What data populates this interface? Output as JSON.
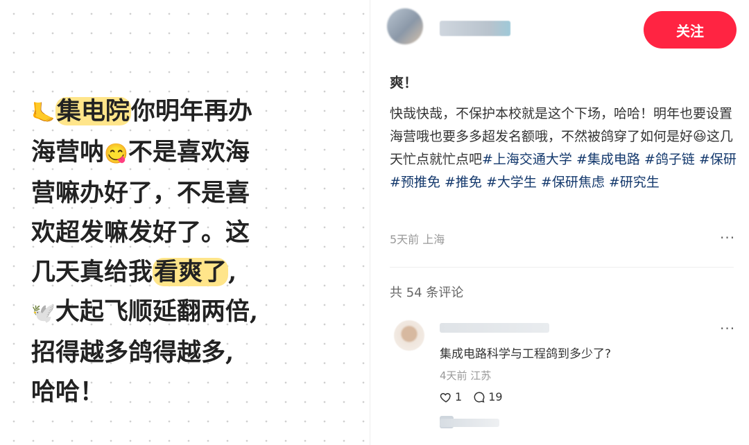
{
  "note_image": {
    "lines": [
      {
        "emoji": "🦶",
        "hl": "集电院",
        "text": "你明年再办"
      },
      {
        "text_a": "海营呐",
        "emoji": "😋",
        "text_b": "不是喜欢海"
      },
      {
        "text": "营嘛办好了，不是喜"
      },
      {
        "text": "欢超发嘛发好了。这"
      },
      {
        "text_a": "几天真给我",
        "hl": "看爽了",
        "text_b": ","
      },
      {
        "emoji": "🕊️",
        "text": "大起飞顺延翻两倍,"
      },
      {
        "text": "招得越多鸽得越多,"
      },
      {
        "text": "哈哈！"
      }
    ]
  },
  "header": {
    "follow_label": "关注"
  },
  "post": {
    "title": "爽！",
    "body_1": "快哉快哉，不保护本校就是这个下场，哈哈！明年也要设置海营哦也要多多超发名额哦，不然被鸽穿了如何是好",
    "body_emoji": "😆",
    "body_2": "这几天忙点就忙点吧",
    "tags": [
      "#上海交通大学",
      "#集成电路",
      "#鸽子链",
      "#保研",
      "#预推免",
      "#推免",
      "#大学生",
      "#保研焦虑",
      "#研究生"
    ],
    "meta": "5天前 上海",
    "more": "···"
  },
  "comments": {
    "count_label": "共 54 条评论",
    "items": [
      {
        "text": "集成电路科学与工程鸽到多少了?",
        "meta": "4天前 江苏",
        "likes": "1",
        "replies": "19",
        "more": "···"
      }
    ]
  },
  "colors": {
    "accent": "#ff2442",
    "tag": "#13386c",
    "highlight": "#ffe58a"
  },
  "icons": [
    "foot-emoji",
    "yum-emoji",
    "dove-emoji",
    "laugh-emoji",
    "heart-icon",
    "comment-icon",
    "more-icon"
  ]
}
